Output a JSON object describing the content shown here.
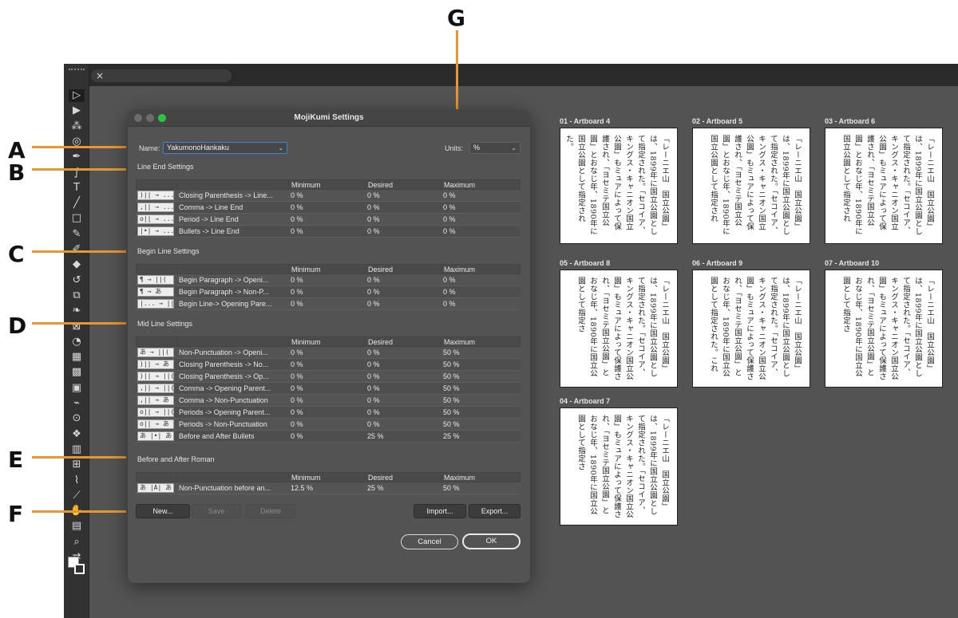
{
  "callouts": [
    "A",
    "B",
    "C",
    "D",
    "E",
    "F",
    "G"
  ],
  "tab": {
    "close_icon": "×"
  },
  "dialog": {
    "title": "MojiKumi Settings",
    "name_label": "Name:",
    "name_value": "YakumonoHankaku",
    "units_label": "Units:",
    "units_value": "%",
    "headers": {
      "minimum": "Minimum",
      "desired": "Desired",
      "maximum": "Maximum"
    },
    "line_end": {
      "title": "Line End Settings",
      "rows": [
        {
          "glyph": ")|| → ...|",
          "name": "Closing Parenthesis -> Line...",
          "min": "0 %",
          "des": "0 %",
          "max": "0 %"
        },
        {
          "glyph": ",|| → ...|",
          "name": "Comma -> Line End",
          "min": "0 %",
          "des": "0 %",
          "max": "0 %"
        },
        {
          "glyph": "o|| → ...|",
          "name": "Period -> Line End",
          "min": "0 %",
          "des": "0 %",
          "max": "0 %"
        },
        {
          "glyph": "|•| → ...|",
          "name": "Bullets -> Line End",
          "min": "0 %",
          "des": "0 %",
          "max": "0 %"
        }
      ]
    },
    "begin_line": {
      "title": "Begin Line Settings",
      "rows": [
        {
          "glyph": "¶ → ||(",
          "name": "Begin Paragraph -> Openi...",
          "min": "0 %",
          "des": "0 %",
          "max": "0 %"
        },
        {
          "glyph": "¶ → あ",
          "name": "Begin Paragraph -> Non-P...",
          "min": "0 %",
          "des": "0 %",
          "max": "0 %"
        },
        {
          "glyph": "|... → ||(",
          "name": "Begin Line-> Opening Pare...",
          "min": "0 %",
          "des": "0 %",
          "max": "0 %"
        }
      ]
    },
    "mid_line": {
      "title": "Mid Line Settings",
      "rows": [
        {
          "glyph": "あ → ||(",
          "name": "Non-Punctuation -> Openi...",
          "min": "0 %",
          "des": "0 %",
          "max": "50 %"
        },
        {
          "glyph": ")|| → あ",
          "name": "Closing Parenthesis -> No...",
          "min": "0 %",
          "des": "0 %",
          "max": "50 %"
        },
        {
          "glyph": ")|| → ||(",
          "name": "Closing Parenthesis -> Op...",
          "min": "0 %",
          "des": "0 %",
          "max": "50 %"
        },
        {
          "glyph": ",|| → ||(",
          "name": "Comma -> Opening Parent...",
          "min": "0 %",
          "des": "0 %",
          "max": "50 %"
        },
        {
          "glyph": ",|| → あ",
          "name": "Comma -> Non-Punctuation",
          "min": "0 %",
          "des": "0 %",
          "max": "50 %"
        },
        {
          "glyph": "o|| → ||(",
          "name": "Periods -> Opening Parent...",
          "min": "0 %",
          "des": "0 %",
          "max": "50 %"
        },
        {
          "glyph": "o|| → あ",
          "name": "Periods -> Non-Punctuation",
          "min": "0 %",
          "des": "0 %",
          "max": "50 %"
        },
        {
          "glyph": "あ |•| あ",
          "name": "Before and After Bullets",
          "min": "0 %",
          "des": "25 %",
          "max": "25 %"
        }
      ]
    },
    "roman": {
      "title": "Before and After Roman",
      "rows": [
        {
          "glyph": "あ |A| あ",
          "name": "Non-Punctuation before an...",
          "min": "12.5 %",
          "des": "25 %",
          "max": "50 %"
        }
      ]
    },
    "buttons": {
      "new": "New...",
      "save": "Save",
      "delete": "Delete",
      "import": "Import...",
      "export": "Export...",
      "cancel": "Cancel",
      "ok": "OK"
    }
  },
  "artboards": [
    {
      "label": "01 - Artboard 4",
      "text": "「レーニエ山　国立公園」は、1899年に国立公園として指定された。「セコイア、キングス・キャニオン国立公園」もミュアによって保護され、「ヨセミテ国立公園」とおなじ年、1890年に国立公園として指定された。"
    },
    {
      "label": "02 - Artboard 5",
      "text": "「レーニエ山　国立公園」は、1899年に国立公園として指定された。「セコイア、キングス・キャニオン国立公園」もミュアによって保護され、「ヨセミテ国立公園」とおなじ年、1890年に国立公園として指定され"
    },
    {
      "label": "03 - Artboard 6",
      "text": "「レーニエ山　国立公園」は、1899年に国立公園として指定された。「セコイア、キングス・キャニオン国立公園」もミュアによって保護され、「ヨセミテ国立公園」とおなじ年、1890年に国立公園として指定され"
    },
    {
      "label": "05 - Artboard 8",
      "text": "「レーニエ山　国立公園」は、1899年に国立公園として指定された。「セコイア、キングス・キャニオン国立公園」もミュアによって保護され、「ヨセミテ国立公園」とおなじ年、1890年に国立公園として指定さ"
    },
    {
      "label": "06 - Artboard 9",
      "text": "「レーニエ山　国立公園」は、1899年に国立公園として指定された。「セコイア、キングス・キャニオン国立公園」もミュアによって保護され、「ヨセミテ国立公園」とおなじ年、1890年に国立公園として指定された。これ"
    },
    {
      "label": "07 - Artboard 10",
      "text": "「レーニエ山　国立公園」は、1899年に国立公園として指定された。「セコイア、キングス・キャニオン国立公園」もミュアによって保護され、「ヨセミテ国立公園」とおなじ年、1890年に国立公園として指定さ"
    },
    {
      "label": "04 - Artboard 7",
      "text": "「レーニエ山　国立公園」は、1899年に国立公園として指定された。「セコイア、キングス・キャニオン国立公園」もミュアによって保護され、「ヨセミテ国立公園」とおなじ年、1890年に国立公園として指定さ"
    }
  ],
  "toolbar": {
    "tools": [
      {
        "icon": "artboard-tool-icon",
        "glyph": "▷"
      },
      {
        "icon": "selection-tool-icon",
        "glyph": "▶"
      },
      {
        "icon": "magic-wand-icon",
        "glyph": "⁂"
      },
      {
        "icon": "lasso-icon",
        "glyph": "◎"
      },
      {
        "icon": "pen-tool-icon",
        "glyph": "✒"
      },
      {
        "icon": "curvature-tool-icon",
        "glyph": "∫"
      },
      {
        "icon": "type-tool-icon",
        "glyph": "T"
      },
      {
        "icon": "line-tool-icon",
        "glyph": "╱"
      },
      {
        "icon": "rectangle-tool-icon",
        "glyph": "□"
      },
      {
        "icon": "paintbrush-icon",
        "glyph": "✎"
      },
      {
        "icon": "shaper-tool-icon",
        "glyph": "✐"
      },
      {
        "icon": "eraser-icon",
        "glyph": "◆"
      },
      {
        "icon": "rotate-tool-icon",
        "glyph": "↺"
      },
      {
        "icon": "scale-tool-icon",
        "glyph": "⧉"
      },
      {
        "icon": "warp-tool-icon",
        "glyph": "❧"
      },
      {
        "icon": "free-transform-icon",
        "glyph": "⊠"
      },
      {
        "icon": "shape-builder-icon",
        "glyph": "◔"
      },
      {
        "icon": "perspective-grid-icon",
        "glyph": "▦"
      },
      {
        "icon": "mesh-tool-icon",
        "glyph": "▩"
      },
      {
        "icon": "gradient-tool-icon",
        "glyph": "▣"
      },
      {
        "icon": "eyedropper-icon",
        "glyph": "⌁"
      },
      {
        "icon": "blend-tool-icon",
        "glyph": "⊙"
      },
      {
        "icon": "symbol-sprayer-icon",
        "glyph": "❖"
      },
      {
        "icon": "column-graph-icon",
        "glyph": "▥"
      },
      {
        "icon": "artboard-resize-icon",
        "glyph": "⊞"
      },
      {
        "icon": "slice-tool-icon",
        "glyph": "⌇"
      },
      {
        "icon": "knife-tool-icon",
        "glyph": "⟋"
      },
      {
        "icon": "hand-tool-icon",
        "glyph": "✋"
      },
      {
        "icon": "print-tiling-icon",
        "glyph": "▤"
      },
      {
        "icon": "zoom-tool-icon",
        "glyph": "⌕"
      },
      {
        "icon": "swap-colors-icon",
        "glyph": "⇄"
      }
    ]
  }
}
